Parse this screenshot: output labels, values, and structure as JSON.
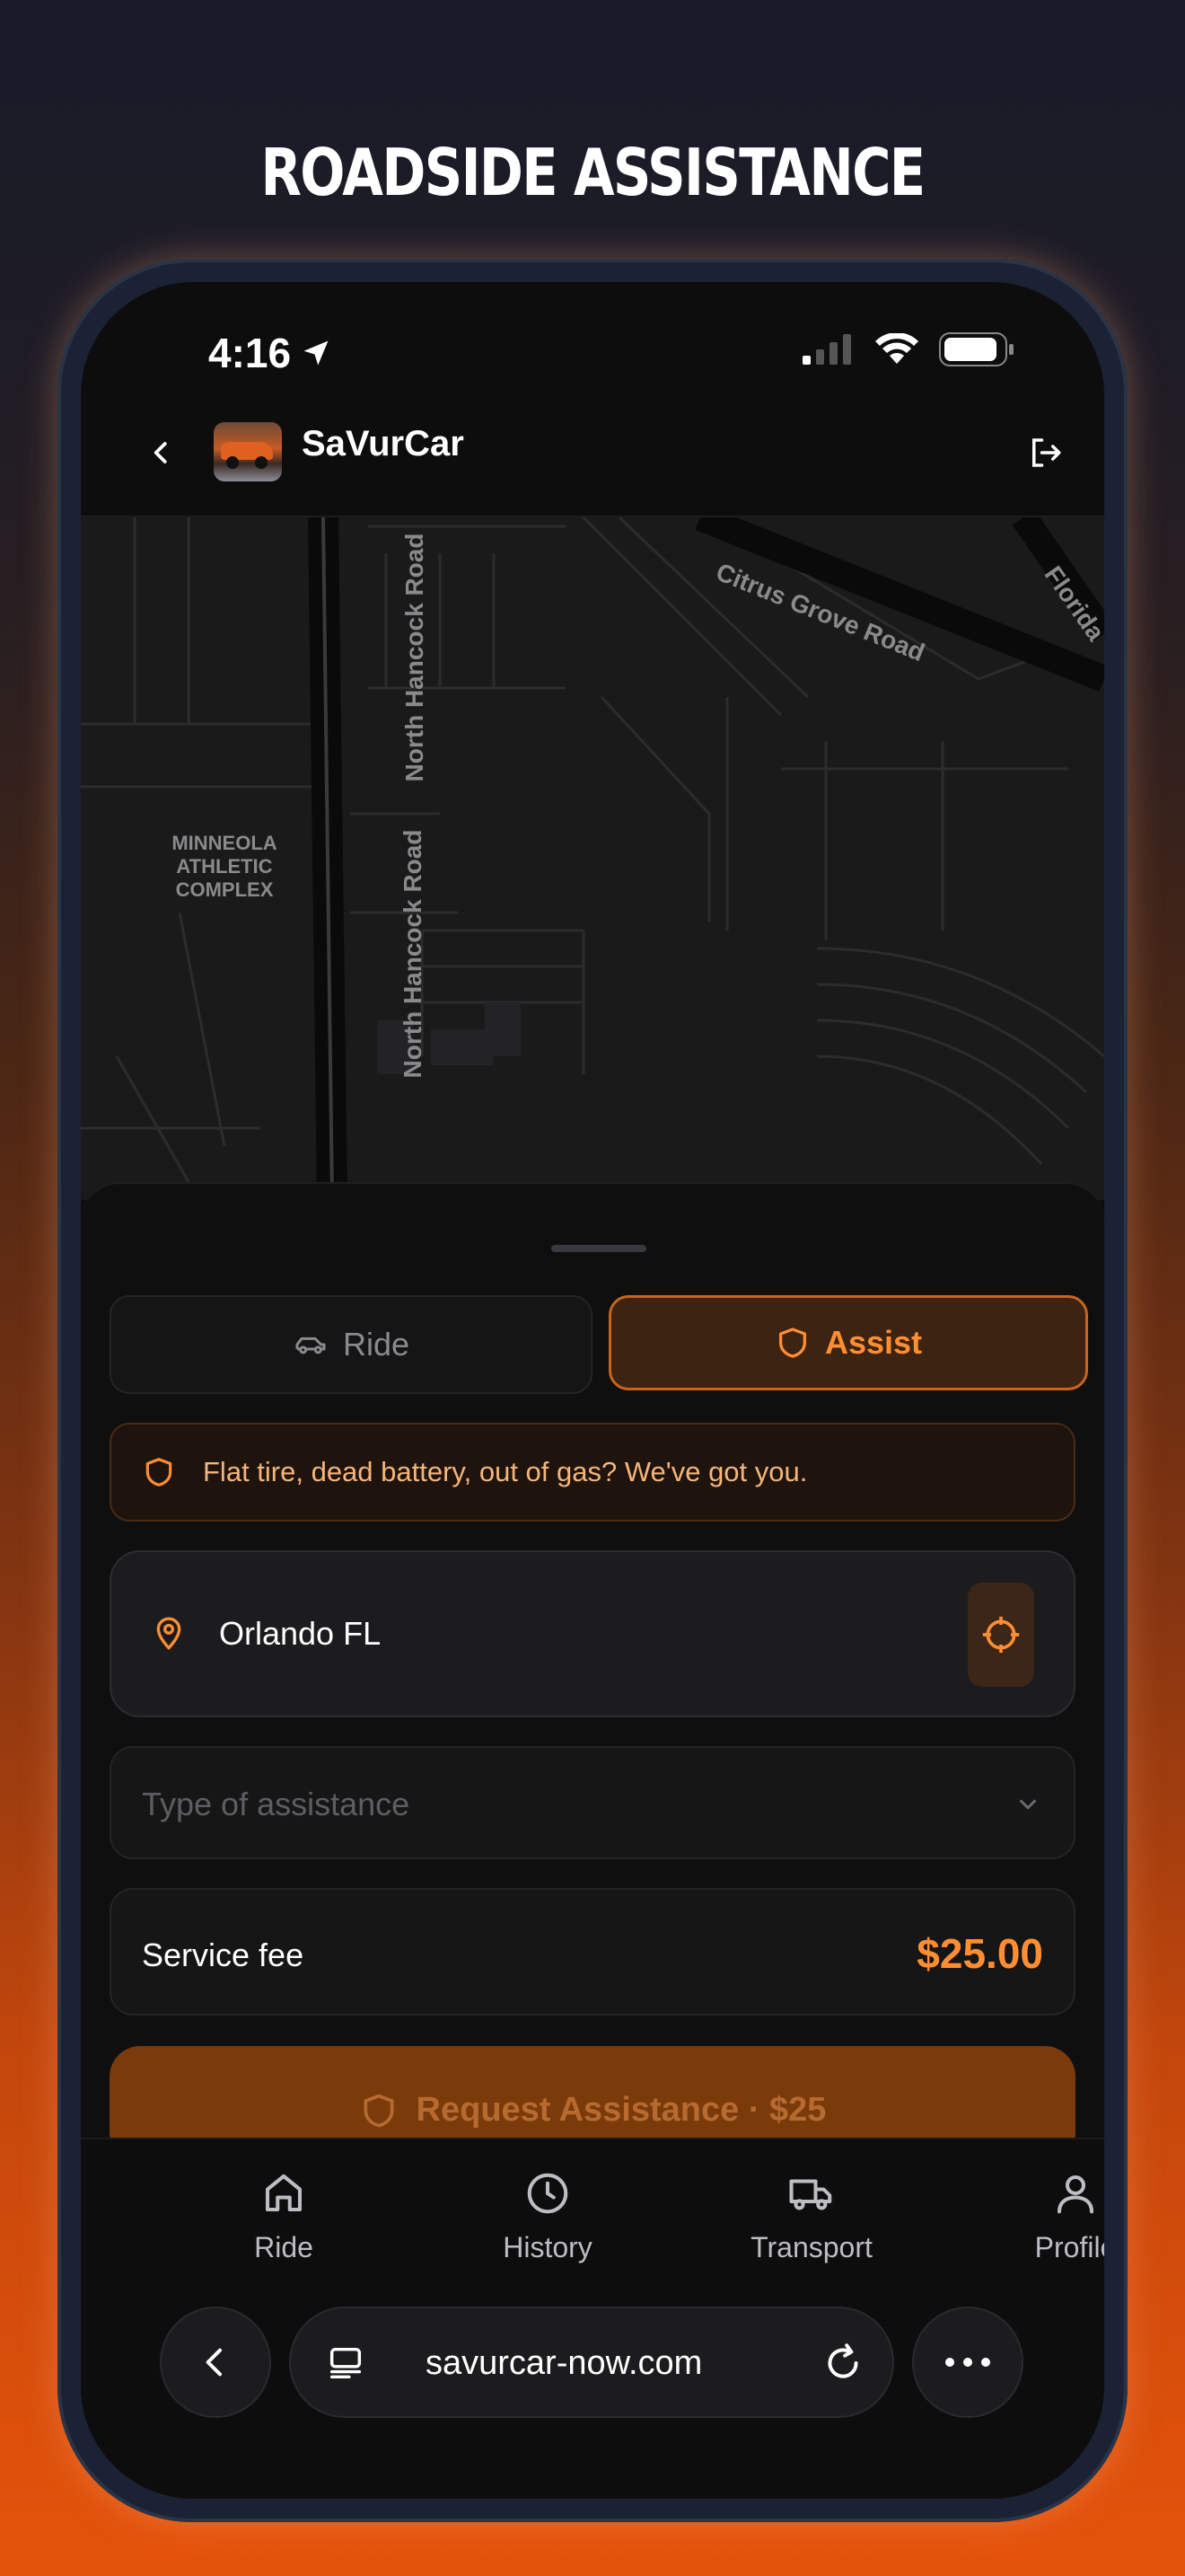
{
  "promo": {
    "title": "ROADSIDE ASSISTANCE"
  },
  "status_bar": {
    "time": "4:16"
  },
  "header": {
    "brand": "SaVurCar"
  },
  "map": {
    "labels": {
      "road_north_1": "North Hancock Road",
      "road_north_2": "North Hancock Road",
      "citrus": "Citrus Grove Road",
      "florida": "Florida",
      "complex_line1": "MINNEOLA",
      "complex_line2": "ATHLETIC",
      "complex_line3": "COMPLEX"
    }
  },
  "tabs": {
    "ride": "Ride",
    "assist": "Assist",
    "active": "assist"
  },
  "banner": {
    "text": "Flat tire, dead battery, out of gas? We've got you."
  },
  "location": {
    "value": "Orlando FL"
  },
  "assistance_type": {
    "placeholder": "Type of assistance"
  },
  "fee": {
    "label": "Service fee",
    "amount": "$25.00"
  },
  "request_button": {
    "label": "Request Assistance · $25"
  },
  "bottom_nav": {
    "items": [
      {
        "label": "Ride",
        "icon": "home-icon"
      },
      {
        "label": "History",
        "icon": "clock-icon"
      },
      {
        "label": "Transport",
        "icon": "truck-icon"
      },
      {
        "label": "Profile",
        "icon": "user-icon"
      }
    ]
  },
  "browser": {
    "url": "savurcar-now.com"
  },
  "colors": {
    "accent": "#ff8e33",
    "accent_dark": "#7a3a0a",
    "background": "#0d0d0e"
  }
}
